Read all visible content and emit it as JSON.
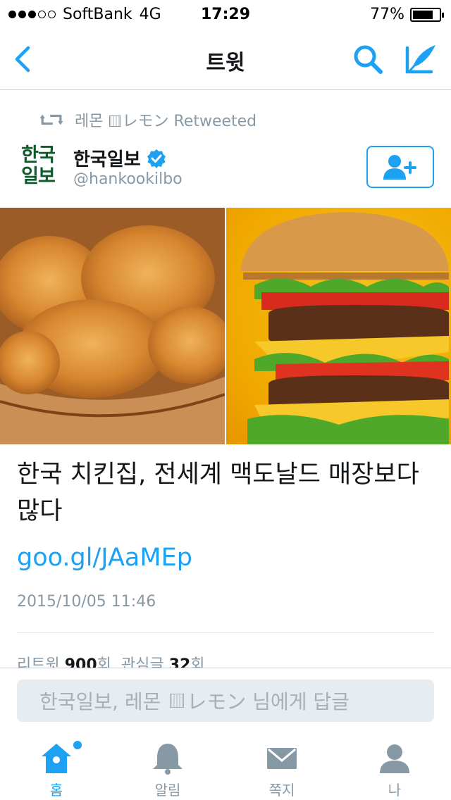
{
  "status_bar": {
    "carrier": "SoftBank",
    "network": "4G",
    "time": "17:29",
    "battery_percent": "77%",
    "battery_level": 0.77,
    "signal_bars": 3
  },
  "nav": {
    "title": "트윗",
    "back_icon": "chevron-left-icon",
    "search_icon": "search-icon",
    "compose_icon": "compose-tweet-icon"
  },
  "tweet": {
    "retweeted_by": "레몬",
    "retweeted_by_kana": "レモン",
    "retweeted_label": "Retweeted",
    "author_logo_line1": "한국",
    "author_logo_line2": "일보",
    "author_name": "한국일보",
    "author_handle": "@hankookilbo",
    "verified": true,
    "follow_icon": "add-user-icon",
    "text": "한국 치킨집, 전세계 맥도날드 매장보다 많다",
    "link": "goo.gl/JAaMEp",
    "date": "2015/10/05 11:46",
    "stats": {
      "retweets_label": "리트윗",
      "retweets_count": "900",
      "count_suffix": "회",
      "likes_label": "관심글",
      "likes_count": "32",
      "likes_suffix": "회"
    }
  },
  "reply": {
    "placeholder_prefix": "한국일보, 레몬",
    "placeholder_kana": "レモン",
    "placeholder_suffix": "님에게 답글"
  },
  "tabs": [
    {
      "label": "홈",
      "icon": "home-icon",
      "active": true
    },
    {
      "label": "알림",
      "icon": "bell-icon",
      "active": false
    },
    {
      "label": "쪽지",
      "icon": "envelope-icon",
      "active": false
    },
    {
      "label": "나",
      "icon": "profile-icon",
      "active": false
    }
  ],
  "colors": {
    "accent": "#1da1f2",
    "muted": "#8899a6",
    "text": "#14171a",
    "logo_green": "#0f5a2b"
  }
}
